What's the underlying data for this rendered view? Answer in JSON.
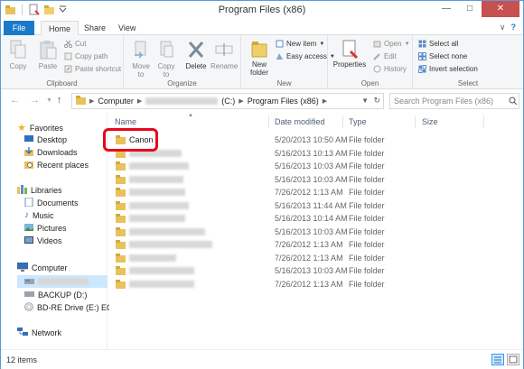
{
  "window": {
    "title": "Program Files (x86)",
    "controls": {
      "minimize": "—",
      "maximize": "□",
      "close": "✕"
    }
  },
  "ribbon_tabs": {
    "file": "File",
    "home": "Home",
    "share": "Share",
    "view": "View",
    "expand": "∨",
    "help": "?"
  },
  "ribbon": {
    "clipboard": {
      "label": "Clipboard",
      "copy": "Copy",
      "paste": "Paste",
      "cut": "Cut",
      "copy_path": "Copy path",
      "paste_shortcut": "Paste shortcut"
    },
    "organize": {
      "label": "Organize",
      "move_to": "Move to",
      "copy_to": "Copy to",
      "delete": "Delete",
      "rename": "Rename"
    },
    "new": {
      "label": "New",
      "new_folder": "New folder",
      "new_item": "New item",
      "easy_access": "Easy access"
    },
    "open": {
      "label": "Open",
      "properties": "Properties",
      "open": "Open",
      "edit": "Edit",
      "history": "History"
    },
    "select": {
      "label": "Select",
      "select_all": "Select all",
      "select_none": "Select none",
      "invert_selection": "Invert selection"
    }
  },
  "address_bar": {
    "crumb_computer": "Computer",
    "crumb_drive_suffix": "(C:)",
    "crumb_current": "Program Files (x86)",
    "search_placeholder": "Search Program Files (x86)"
  },
  "nav_pane": {
    "favorites": "Favorites",
    "desktop": "Desktop",
    "downloads": "Downloads",
    "recent_places": "Recent places",
    "libraries": "Libraries",
    "documents": "Documents",
    "music": "Music",
    "pictures": "Pictures",
    "videos": "Videos",
    "computer": "Computer",
    "backup": "BACKUP (D:)",
    "bd_drive": "BD-RE Drive (E:) EOS",
    "network": "Network"
  },
  "columns": {
    "name": "Name",
    "date_modified": "Date modified",
    "type": "Type",
    "size": "Size"
  },
  "files": [
    {
      "name": "Canon",
      "date": "5/20/2013 10:50 AM",
      "type": "File folder"
    },
    {
      "name": "",
      "date": "5/16/2013 10:13 AM",
      "type": "File folder"
    },
    {
      "name": "",
      "date": "5/16/2013 10:03 AM",
      "type": "File folder"
    },
    {
      "name": "",
      "date": "5/16/2013 10:03 AM",
      "type": "File folder"
    },
    {
      "name": "",
      "date": "7/26/2012 1:13 AM",
      "type": "File folder"
    },
    {
      "name": "",
      "date": "5/16/2013 11:44 AM",
      "type": "File folder"
    },
    {
      "name": "",
      "date": "5/16/2013 10:14 AM",
      "type": "File folder"
    },
    {
      "name": "",
      "date": "5/16/2013 10:03 AM",
      "type": "File folder"
    },
    {
      "name": "",
      "date": "7/26/2012 1:13 AM",
      "type": "File folder"
    },
    {
      "name": "",
      "date": "7/26/2012 1:13 AM",
      "type": "File folder"
    },
    {
      "name": "",
      "date": "5/16/2013 10:03 AM",
      "type": "File folder"
    },
    {
      "name": "",
      "date": "7/26/2012 1:13 AM",
      "type": "File folder"
    }
  ],
  "status": {
    "items": "12 items"
  },
  "colors": {
    "accent": "#1979ca",
    "highlight": "#e8071a",
    "folder": "#e8c25a"
  }
}
